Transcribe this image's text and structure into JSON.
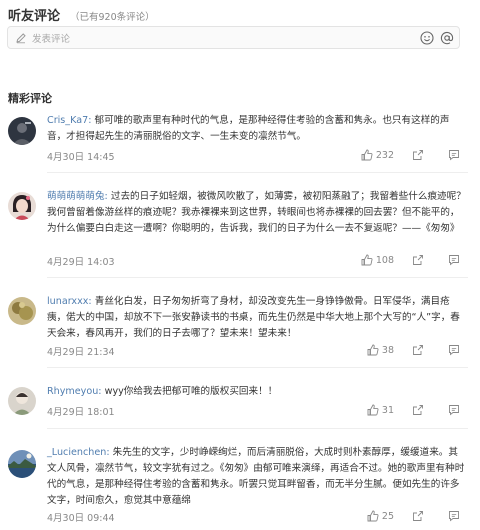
{
  "header": {
    "title": "听友评论",
    "count": "（已有920条评论）"
  },
  "input": {
    "placeholder": "发表评论"
  },
  "section_title": "精彩评论",
  "comments": [
    {
      "user": "Cris_Ka7:",
      "text": " 郁可唯的歌声里有种时代的气息，是那种经得住考验的含蓄和隽永。也只有这样的声音，才担得起先生的清丽脱俗的文字、一生未变的凛然节气。",
      "time": "4月30日 14:45",
      "likes": "232"
    },
    {
      "user": "萌萌萌萌萌兔:",
      "text": " 过去的日子如轻烟，被微风吹散了，如薄雾，被初阳蒸融了；我留着些什么痕迹呢？我何曾留着像游丝样的痕迹呢？我赤裸裸来到这世界，转眼间也将赤裸裸的回去罢？但不能平的，为什么偏要白白走这一遭啊？你聪明的，告诉我，我们的日子为什么一去不复返呢？——《匆匆》",
      "time": "4月29日 14:03",
      "likes": "108"
    },
    {
      "user": "lunarxxx:",
      "text": " 青丝化白发，日子匆匆折弯了身材，却没改变先生一身铮铮傲骨。日军侵华，满目疮痍，偌大的中国，却放不下一张安静读书的书桌，而先生仍然是中华大地上那个大写的“人”字，春天会来，春风再开，我们的日子去哪了？望未来！望未来！",
      "time": "4月29日 21:34",
      "likes": "38"
    },
    {
      "user": "Rhymeyou:",
      "text": " wyy你给我去把郁可唯的版权买回来！！",
      "time": "4月29日 18:01",
      "likes": "31"
    },
    {
      "user": "_Lucienchen:",
      "text": " 朱先生的文字，少时峥嵘绚烂，而后清丽脱俗，大成时则朴素醇厚，缓缓道来。其文人风骨，凛然节气，较文字犹有过之。《匆匆》由郁可唯来演绎，再适合不过。她的歌声里有种时代的气息，是那种经得住考验的含蓄和隽永。听罢只觉耳畔留香，而无半分生腻。便如先生的许多文字，时间愈久，愈觉其中意蕴绵",
      "time": "4月30日 09:44",
      "likes": "25"
    }
  ],
  "colors": {
    "username": "#507daf",
    "meta": "#888888",
    "text": "#333333"
  }
}
